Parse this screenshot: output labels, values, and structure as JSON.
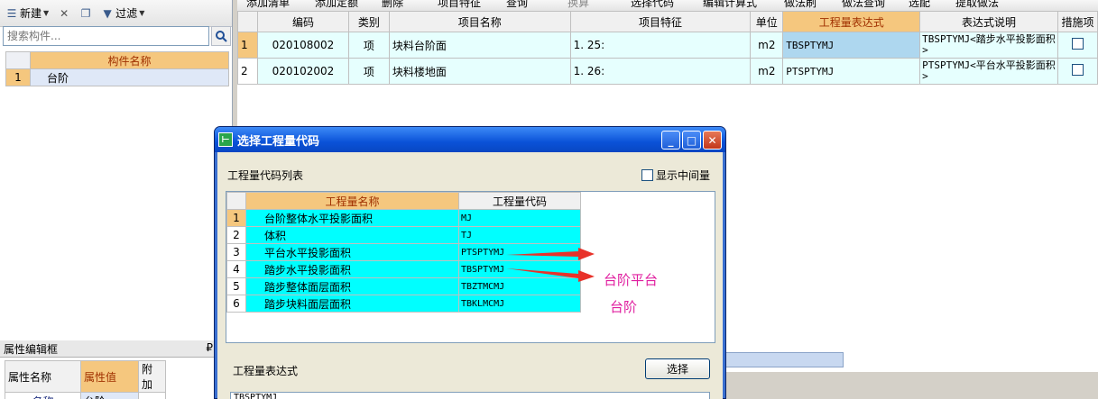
{
  "left_toolbar": {
    "new_label": "新建",
    "filter_label": "过滤"
  },
  "search": {
    "placeholder": "搜索构件..."
  },
  "component_list": {
    "header": "构件名称",
    "rows": [
      {
        "num": "1",
        "name": "台阶"
      }
    ]
  },
  "property_panel": {
    "title": "属性编辑框",
    "pin": "₽",
    "headers": [
      "属性名称",
      "属性值",
      "附加"
    ],
    "rows": [
      {
        "name": "名称",
        "value": "台阶"
      }
    ]
  },
  "right_toolbar": {
    "items": [
      "添加清单",
      "添加定额",
      "删除",
      "项目特征",
      "查询",
      "换算",
      "选择代码",
      "编辑计算式",
      "做法刷",
      "做法查询",
      "选配",
      "提取做法"
    ]
  },
  "main_table": {
    "headers": [
      "编码",
      "类别",
      "项目名称",
      "项目特征",
      "单位",
      "工程量表达式",
      "表达式说明",
      "措施项"
    ],
    "rows": [
      {
        "num": "1",
        "code": "020108002",
        "type": "项",
        "name": "块料台阶面",
        "feature": "1. 25:",
        "unit": "m2",
        "expr": "TBSPTYMJ",
        "desc": "TBSPTYMJ<踏步水平投影面积>"
      },
      {
        "num": "2",
        "code": "020102002",
        "type": "项",
        "name": "块料楼地面",
        "feature": "1. 26:",
        "unit": "m2",
        "expr": "PTSPTYMJ",
        "desc": "PTSPTYMJ<平台水平投影面积>"
      }
    ]
  },
  "dialog": {
    "title": "选择工程量代码",
    "list_label": "工程量代码列表",
    "show_middle_label": "显示中间量",
    "headers": [
      "工程量名称",
      "工程量代码"
    ],
    "rows": [
      {
        "num": "1",
        "name": "台阶整体水平投影面积",
        "code": "MJ"
      },
      {
        "num": "2",
        "name": "体积",
        "code": "TJ"
      },
      {
        "num": "3",
        "name": "平台水平投影面积",
        "code": "PTSPTYMJ"
      },
      {
        "num": "4",
        "name": "踏步水平投影面积",
        "code": "TBSPTYMJ"
      },
      {
        "num": "5",
        "name": "踏步整体面层面积",
        "code": "TBZTMCMJ"
      },
      {
        "num": "6",
        "name": "踏步块料面层面积",
        "code": "TBKLMCMJ"
      }
    ],
    "annotation_1": "台阶平台",
    "annotation_2": "台阶",
    "expr_label": "工程量表达式",
    "select_button": "选择",
    "expr_value": "TBSPTYMJ",
    "annotation_color": "#e020a0",
    "arrow_color": "#e8322a"
  }
}
